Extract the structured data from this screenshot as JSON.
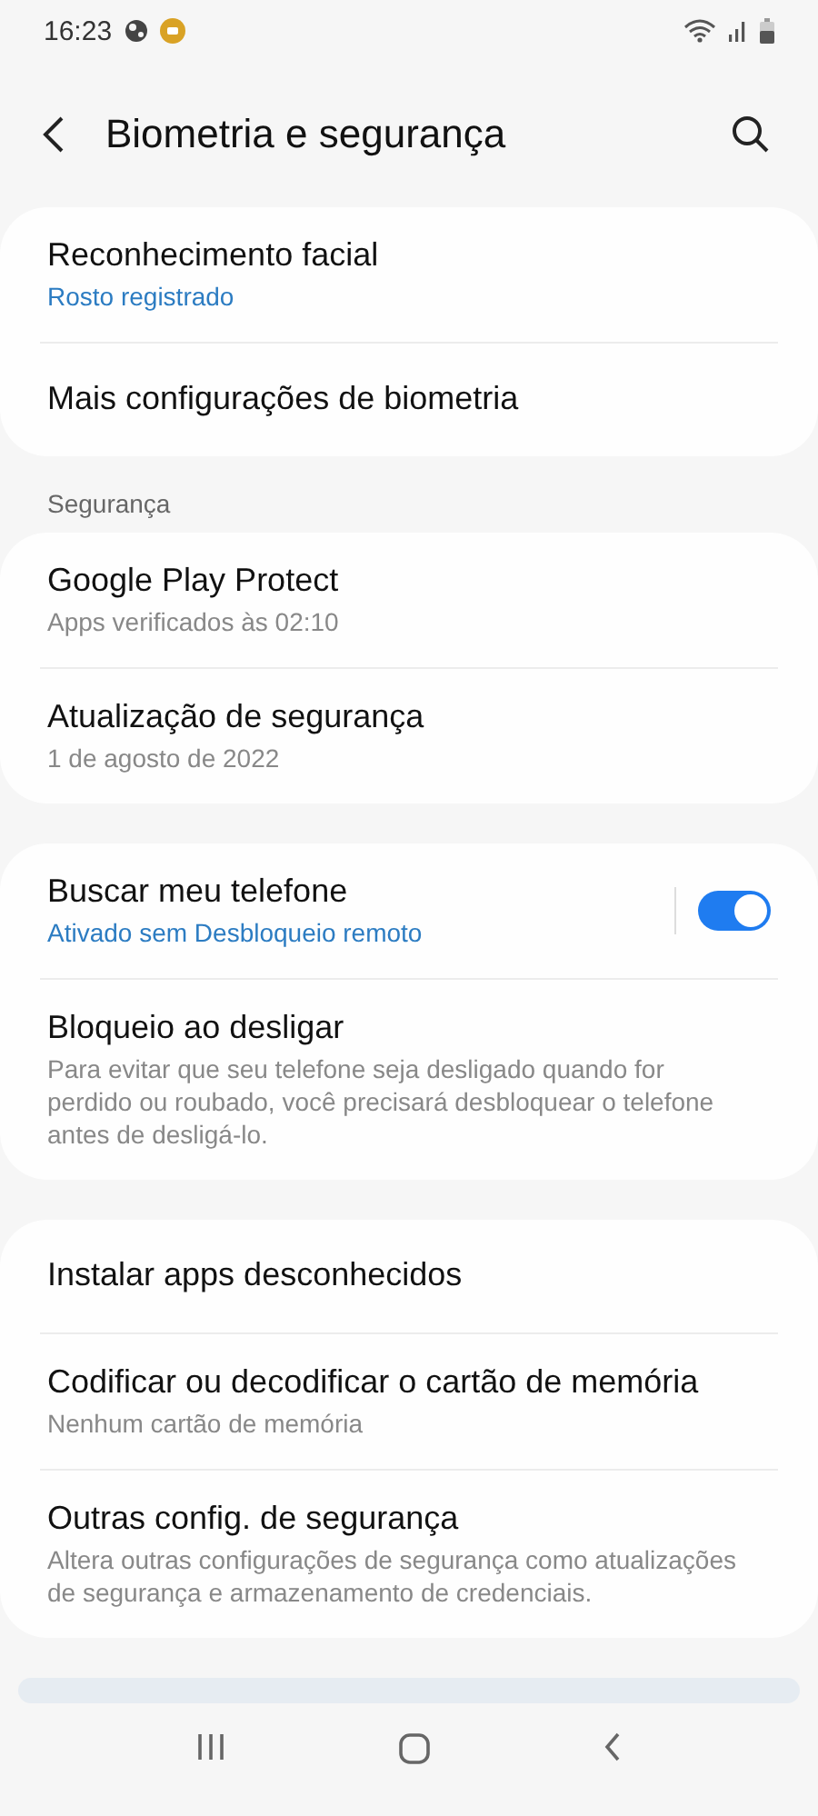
{
  "status_bar": {
    "time": "16:23"
  },
  "header": {
    "title": "Biometria e segurança"
  },
  "groups": [
    {
      "items": [
        {
          "title": "Reconhecimento facial",
          "subtitle": "Rosto registrado",
          "accent": true
        },
        {
          "title": "Mais configurações de biometria"
        }
      ]
    },
    {
      "label": "Segurança",
      "items": [
        {
          "title": "Google Play Protect",
          "subtitle": "Apps verificados às 02:10",
          "accent": false
        },
        {
          "title": "Atualização de segurança",
          "subtitle": "1 de agosto de 2022",
          "accent": false
        }
      ]
    },
    {
      "items": [
        {
          "title": "Buscar meu telefone",
          "subtitle": "Ativado sem Desbloqueio remoto",
          "accent": true,
          "toggle": {
            "on": true
          }
        },
        {
          "title": "Bloqueio ao desligar",
          "subtitle": "Para evitar que seu telefone seja desligado quando for perdido ou roubado, você precisará desbloquear o telefone antes de desligá-lo.",
          "accent": false
        }
      ]
    },
    {
      "items": [
        {
          "title": "Instalar apps desconhecidos"
        },
        {
          "title": "Codificar ou decodificar o cartão de memória",
          "subtitle": "Nenhum cartão de memória",
          "accent": false
        },
        {
          "title": "Outras config. de segurança",
          "subtitle": "Altera outras configurações de segurança como atualizações de segurança e armazenamento de credenciais.",
          "accent": false
        }
      ]
    }
  ]
}
